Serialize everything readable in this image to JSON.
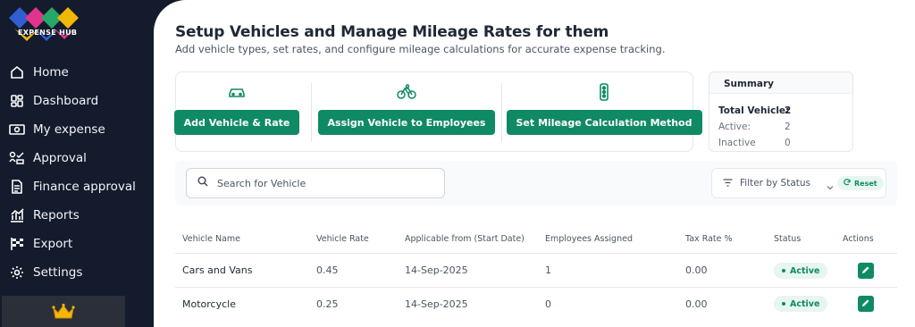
{
  "brand": {
    "name": "EXPENSE HUB"
  },
  "sidebar": {
    "items": [
      {
        "label": "Home",
        "icon": "home-icon"
      },
      {
        "label": "Dashboard",
        "icon": "dashboard-icon"
      },
      {
        "label": "My expense",
        "icon": "money-icon"
      },
      {
        "label": "Approval",
        "icon": "approval-icon"
      },
      {
        "label": "Finance approval",
        "icon": "document-icon"
      },
      {
        "label": "Reports",
        "icon": "chart-icon"
      },
      {
        "label": "Export",
        "icon": "flag-icon"
      },
      {
        "label": "Settings",
        "icon": "gear-icon"
      }
    ],
    "premium_icon": "crown-icon"
  },
  "page": {
    "title": "Setup Vehicles and Manage Mileage Rates for them",
    "subtitle": "Add vehicle types, set rates, and configure mileage calculations for accurate expense tracking."
  },
  "actions": [
    {
      "label": "Add Vehicle & Rate",
      "icon": "car-icon"
    },
    {
      "label": "Assign Vehicle to Employees",
      "icon": "bicycle-icon"
    },
    {
      "label": "Set Mileage Calculation Method",
      "icon": "traffic-light-icon"
    }
  ],
  "summary": {
    "title": "Summary",
    "total_label": "Total Vehicle:",
    "total_value": "2",
    "active_label": "Active:",
    "active_value": "2",
    "inactive_label": "Inactive",
    "inactive_value": "0"
  },
  "search": {
    "placeholder": "Search for Vehicle",
    "value": ""
  },
  "filter": {
    "label": "Filter by Status",
    "reset_label": "Reset"
  },
  "table": {
    "headers": [
      "Vehicle Name",
      "Vehicle Rate",
      "Applicable from (Start Date)",
      "Employees Assigned",
      "Tax Rate %",
      "Status",
      "Actions"
    ],
    "rows": [
      {
        "name": "Cars and Vans",
        "rate": "0.45",
        "start": "14-Sep-2025",
        "employees": "1",
        "tax": "0.00",
        "status": "Active"
      },
      {
        "name": "Motorcycle",
        "rate": "0.25",
        "start": "14-Sep-2025",
        "employees": "0",
        "tax": "0.00",
        "status": "Active"
      }
    ]
  },
  "colors": {
    "accent": "#0f8a64",
    "sidebar_bg": "#141b2d",
    "active_bg": "#e7f6ef"
  }
}
